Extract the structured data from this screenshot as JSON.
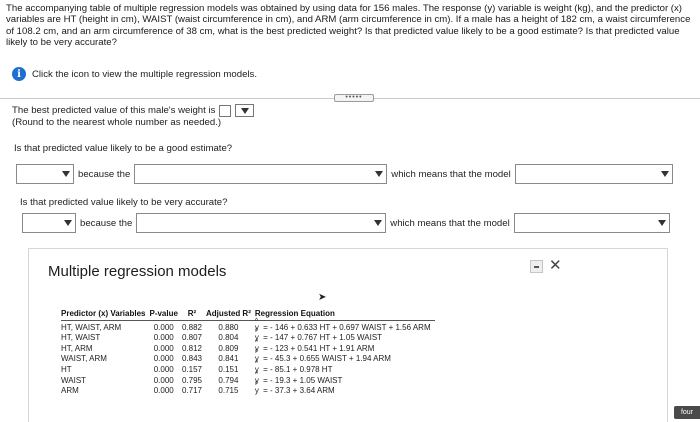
{
  "question": {
    "text": "The accompanying table of multiple regression models was obtained by using data for 156 males. The response (y) variable is weight (kg), and the predictor (x) variables are HT (height in cm), WAIST (waist circumference in cm), and ARM (arm circumference in cm). If a male has a height of 182 cm, a waist circumference of 108.2 cm, and an arm circumference of 38 cm, what is the best predicted weight? Is that predicted value likely to be a good estimate? Is that predicted value likely to be very accurate?"
  },
  "info": {
    "text": "Click the icon to view the multiple regression models."
  },
  "answer1": {
    "line1": "The best predicted value of this male's weight is",
    "line2": "(Round to the nearest whole number as needed.)"
  },
  "question2": "Is that predicted value likely to be a good estimate?",
  "question3": "Is that predicted value likely to be very accurate?",
  "row_a": {
    "because": "because the",
    "means": "which means that the model"
  },
  "row_b": {
    "because": "because the",
    "means": "which means that the model"
  },
  "dialog": {
    "title": "Multiple regression models",
    "headers": {
      "predictor": "Predictor (x) Variables",
      "pvalue": "P-value",
      "r2": "R²",
      "adj": "Adjusted R²",
      "eq": "Regression Equation"
    },
    "rows": [
      {
        "pred": "HT, WAIST, ARM",
        "p": "0.000",
        "r2": "0.882",
        "adj": "0.880",
        "eq": " = - 146 + 0.633 HT + 0.697 WAIST + 1.56 ARM"
      },
      {
        "pred": "HT, WAIST",
        "p": "0.000",
        "r2": "0.807",
        "adj": "0.804",
        "eq": " = - 147 + 0.767 HT + 1.05 WAIST"
      },
      {
        "pred": "HT, ARM",
        "p": "0.000",
        "r2": "0.812",
        "adj": "0.809",
        "eq": " = - 123 + 0.541 HT + 1.91 ARM"
      },
      {
        "pred": "WAIST, ARM",
        "p": "0.000",
        "r2": "0.843",
        "adj": "0.841",
        "eq": " = - 45.3 + 0.655 WAIST + 1.94 ARM"
      },
      {
        "pred": "HT",
        "p": "0.000",
        "r2": "0.157",
        "adj": "0.151",
        "eq": " = - 85.1 + 0.978 HT"
      },
      {
        "pred": "WAIST",
        "p": "0.000",
        "r2": "0.795",
        "adj": "0.794",
        "eq": " = - 19.3 + 1.05 WAIST"
      },
      {
        "pred": "ARM",
        "p": "0.000",
        "r2": "0.717",
        "adj": "0.715",
        "eq": " = - 37.3 + 3.64 ARM"
      }
    ]
  },
  "badge": {
    "text": "four"
  },
  "colors": {
    "info_icon": "#1f6fd1",
    "badge": "#4a4a4a"
  }
}
